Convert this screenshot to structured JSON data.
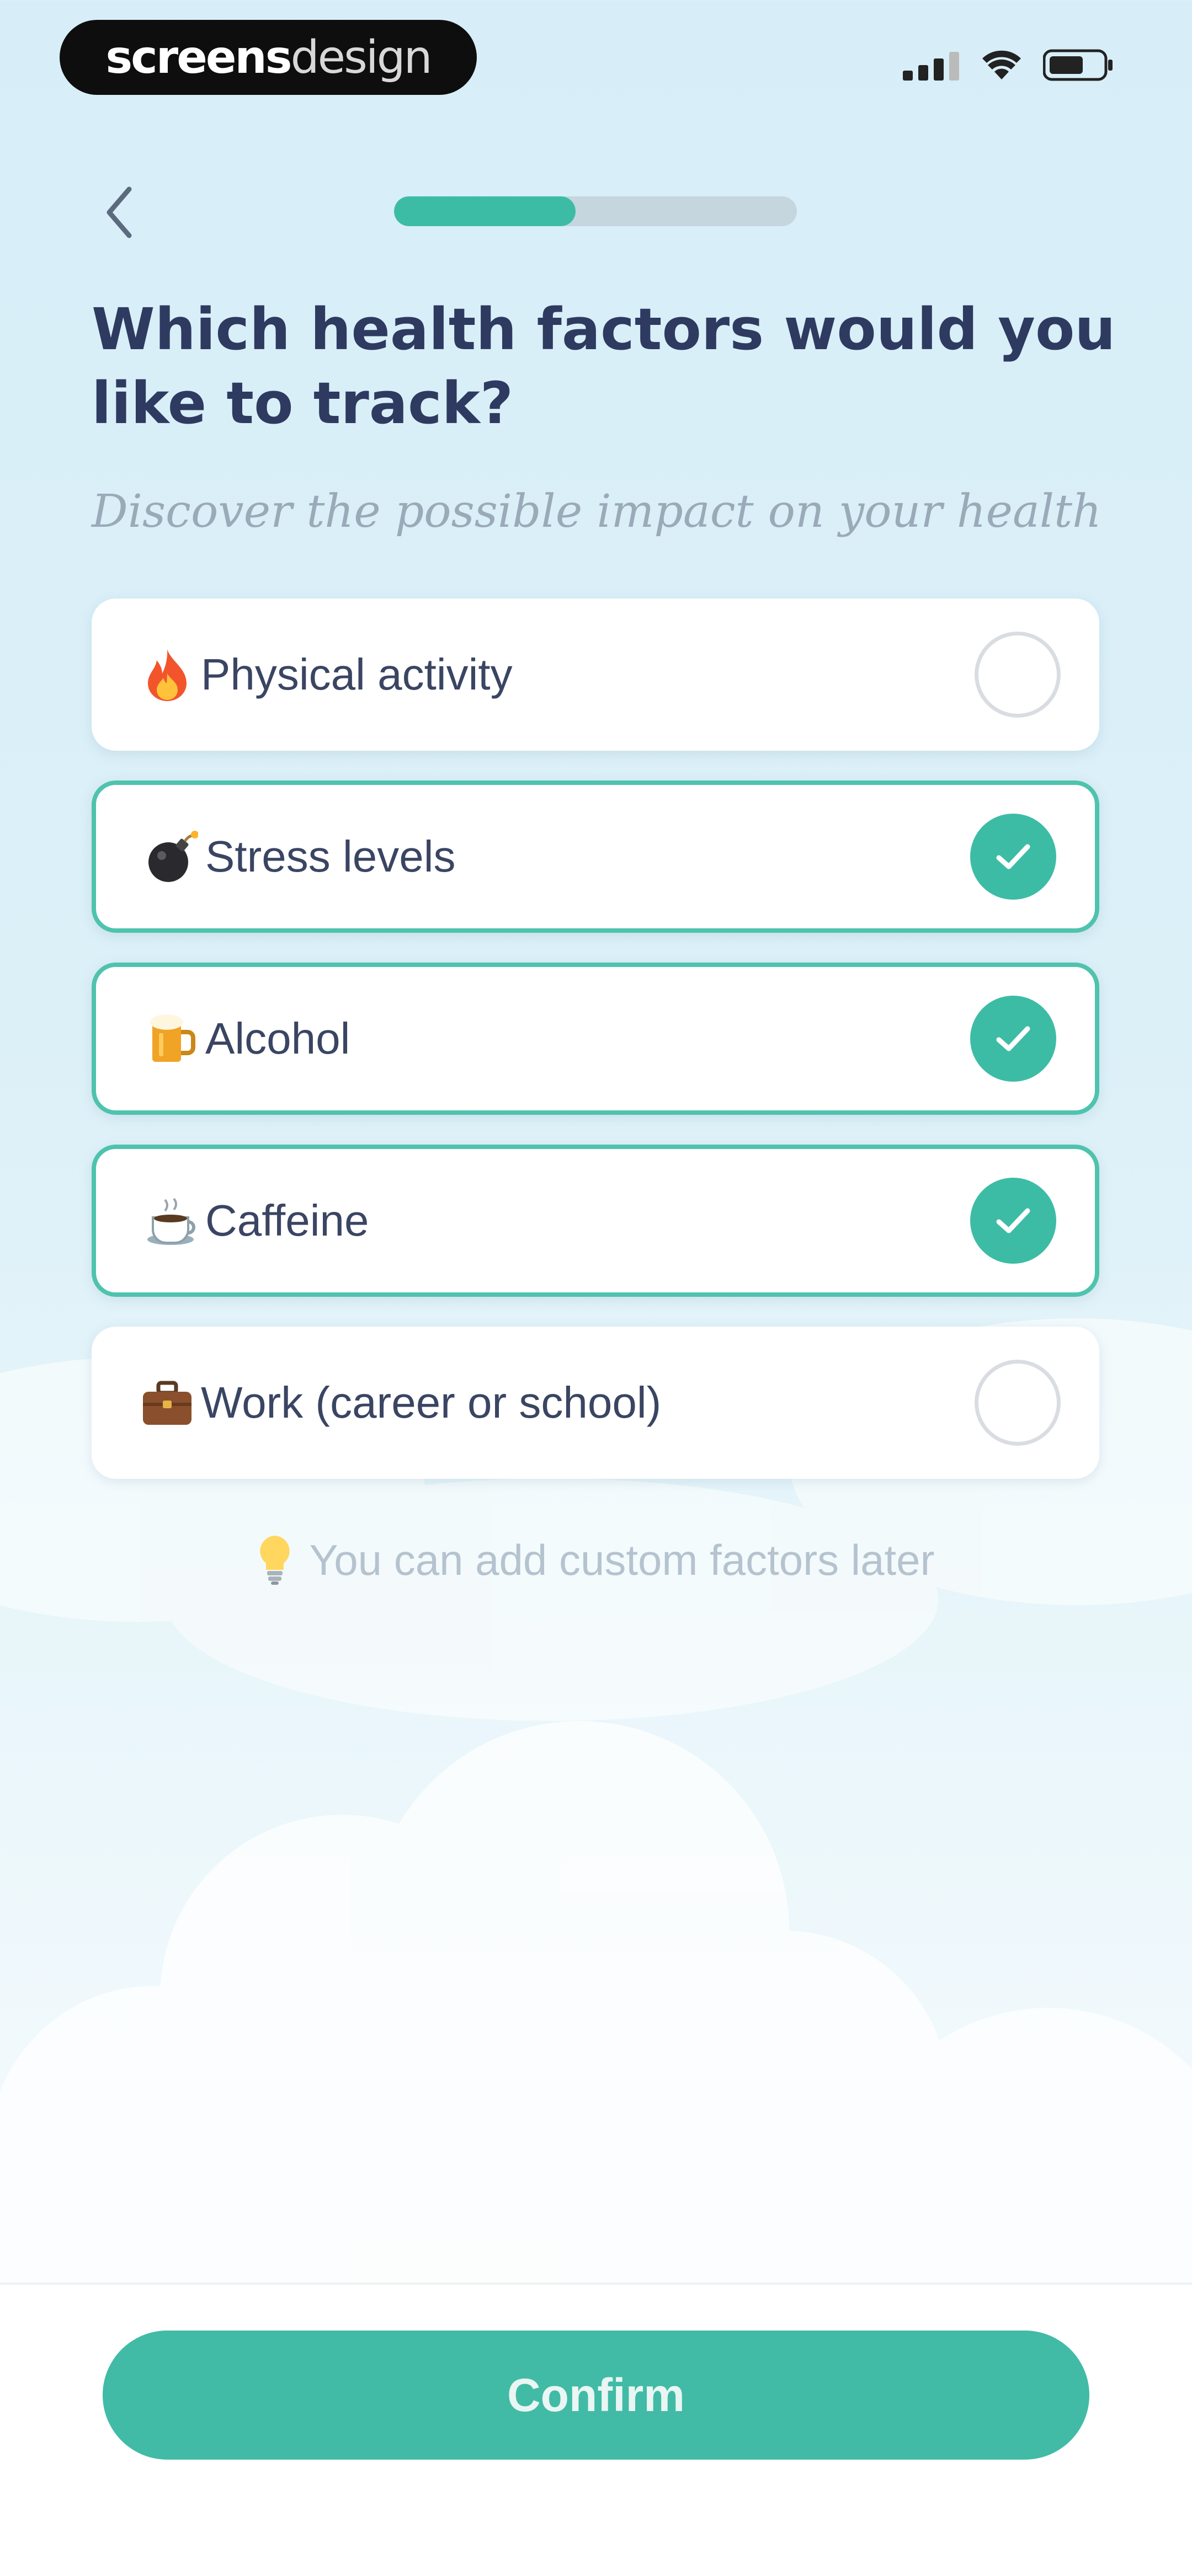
{
  "watermark": {
    "part1": "screens",
    "part2": "design"
  },
  "status_bar": {
    "icons": [
      "cellular-signal-icon",
      "wifi-icon",
      "battery-icon"
    ]
  },
  "header": {
    "back_icon": "chevron-left-icon",
    "progress_fraction": 0.45
  },
  "question": {
    "title": "Which health factors would you like to track?",
    "subtitle": "Discover the possible impact on your health"
  },
  "options": [
    {
      "emoji": "fire-icon",
      "label": "Physical activity",
      "selected": false
    },
    {
      "emoji": "bomb-icon",
      "label": "Stress levels",
      "selected": true
    },
    {
      "emoji": "beer-mug-icon",
      "label": "Alcohol",
      "selected": true
    },
    {
      "emoji": "coffee-cup-icon",
      "label": "Caffeine",
      "selected": true
    },
    {
      "emoji": "briefcase-icon",
      "label": "Work (career or school)",
      "selected": false
    }
  ],
  "hint": {
    "icon": "lightbulb-icon",
    "text": "You can add custom factors later"
  },
  "footer": {
    "confirm_label": "Confirm"
  },
  "colors": {
    "accent": "#3dbca5",
    "title": "#2e3a60",
    "muted": "#9aaab8"
  }
}
